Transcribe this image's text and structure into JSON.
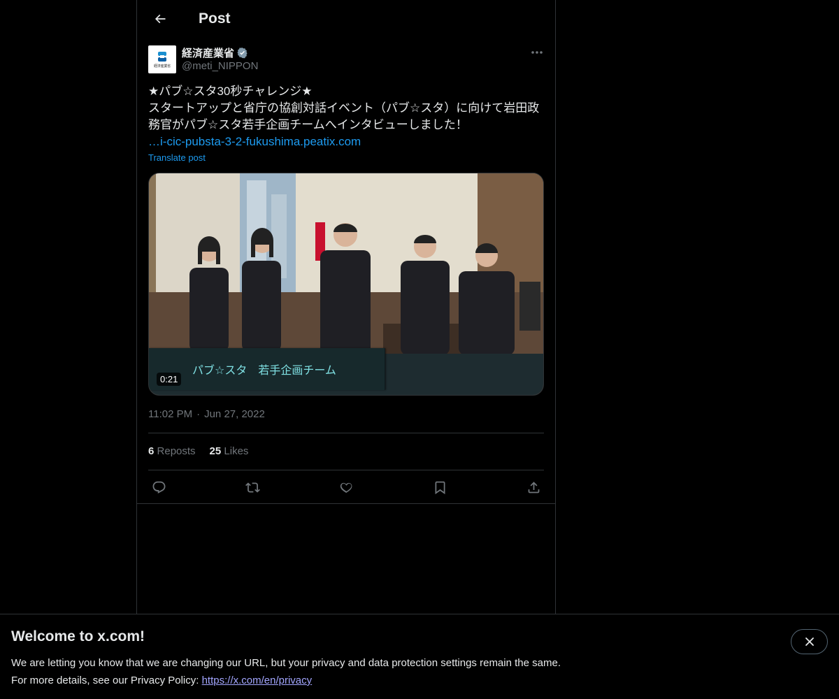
{
  "header": {
    "title": "Post"
  },
  "author": {
    "avatar_text": "経済産業省",
    "display_name": "経済産業省",
    "handle": "@meti_NIPPON"
  },
  "post": {
    "line1": "★パブ☆スタ30秒チャレンジ★",
    "line2": "スタートアップと省庁の協創対話イベント（パブ☆スタ）に向けて岩田政務官がパブ☆スタ若手企画チームへインタビューしました！",
    "link": "…i-cic-pubsta-3-2-fukushima.peatix.com",
    "translate_label": "Translate post"
  },
  "media": {
    "caption": "パブ☆スタ　若手企画チーム",
    "duration": "0:21"
  },
  "meta": {
    "time": "11:02 PM",
    "separator": "·",
    "date": "Jun 27, 2022"
  },
  "stats": {
    "reposts_count": "6",
    "reposts_label": "Reposts",
    "likes_count": "25",
    "likes_label": "Likes"
  },
  "actions": [
    "reply-icon",
    "repost-icon",
    "like-icon",
    "bookmark-icon",
    "share-icon"
  ],
  "banner": {
    "title": "Welcome to x.com!",
    "line1": "We are letting you know that we are changing our URL, but your privacy and data protection settings remain the same.",
    "line2_prefix": "For more details, see our Privacy Policy: ",
    "link": "https://x.com/en/privacy"
  },
  "colors": {
    "background": "#000000",
    "accent": "#1d9bf0",
    "muted": "#71767b",
    "border": "#2f3336"
  }
}
